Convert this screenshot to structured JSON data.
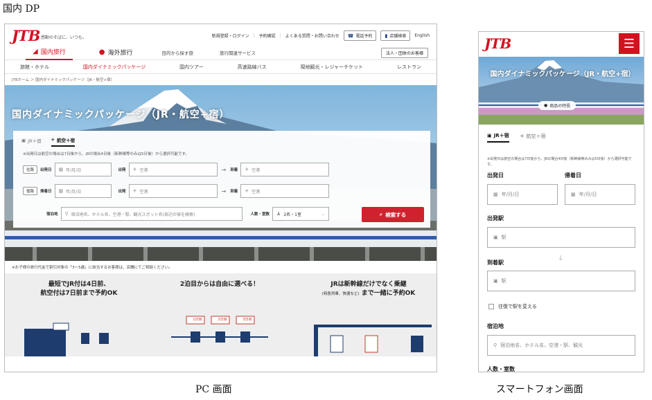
{
  "captions": {
    "section": "国内 DP",
    "pc": "PC 画面",
    "sp": "スマートフォン画面"
  },
  "brand": {
    "logo": "JTB",
    "tagline": "感動のそばに、いつも。",
    "red": "#d4121f"
  },
  "pc": {
    "util": {
      "signup": "新規登録・ログイン",
      "confirm": "予約確認",
      "faq": "よくある質問・お問い合わせ",
      "phone": "電話予約",
      "store": "店舗検索",
      "english": "English"
    },
    "nav1": {
      "domestic": "国内旅行",
      "overseas": "海外旅行",
      "purpose": "目的から探す旅",
      "services": "旅行関連サービス",
      "corporate": "法人・団体のお客様"
    },
    "nav2": [
      "旅館・ホテル",
      "国内ダイナミックパッケージ",
      "国内ツアー",
      "高速路線バス",
      "現地観光・レジャーチケット",
      "レストラン"
    ],
    "breadcrumb": "JTBホーム ＞ 国内ダイナミックパッケージ（JR・航空+宿）",
    "hero_title": "国内ダイナミックパッケージ（JR・航空+宿）",
    "tabs": {
      "jr": "JR＋宿",
      "air": "航空＋宿"
    },
    "notice": "※出発日は航空の場合は7日後から、JRの場合4日後（新幹線等のみは5日後）から選択可能です。",
    "outbound": {
      "tag": "往路",
      "date_label": "出発日",
      "date_ph": "年/月/日",
      "from_label": "出発",
      "from_ph": "空港",
      "to_label": "到着",
      "to_ph": "空港"
    },
    "inbound": {
      "tag": "復路",
      "date_label": "帰着日",
      "date_ph": "年/月/日",
      "from_label": "出発",
      "from_ph": "空港",
      "to_label": "到着",
      "to_ph": "空港"
    },
    "stay_label": "宿泊地",
    "stay_ph": "宿泊地名、ホテル名、空港・駅、観光スポット名(周辺の宿を検索)",
    "pax_label": "人数・室数",
    "pax_value": "2名・1室",
    "search_label": "検索する",
    "note": "※お子様の旅行代金で割引対象の「3〜5歳」に該当するお客様は、店舗にてご相談ください。",
    "features": [
      {
        "line1": "最短でJR付は4日前、",
        "line2": "航空付は7日前まで予約OK",
        "sub": ""
      },
      {
        "line1": "2泊目からは自由に選べる！",
        "line2": "",
        "sub": ""
      },
      {
        "line1": "JRは新幹線だけでなく乗継",
        "line2": "まで一緒に予約OK",
        "sub": "(特急列車、快速など)"
      }
    ],
    "days": [
      "1日目",
      "2日目",
      "3日目"
    ]
  },
  "sp": {
    "hero_title": "国内ダイナミックパッケージ（JR・航空+宿）",
    "pill": "商品の特長",
    "tabs": {
      "jr": "JR＋宿",
      "air": "航空＋宿"
    },
    "notice": "※出発日は航空の場合は7日後から、JRの場合4日後（新幹線等のみは5日後）から選択可能です。",
    "depart_label": "出発日",
    "return_label": "帰着日",
    "date_ph": "年/月/日",
    "from_label": "出発駅",
    "to_label": "到着駅",
    "station_ph": "駅",
    "check_label": "往復で駅を変える",
    "stay_label": "宿泊地",
    "stay_ph": "宿泊地名、ホテル名、空港・駅、観光",
    "pax_label": "人数・室数"
  }
}
